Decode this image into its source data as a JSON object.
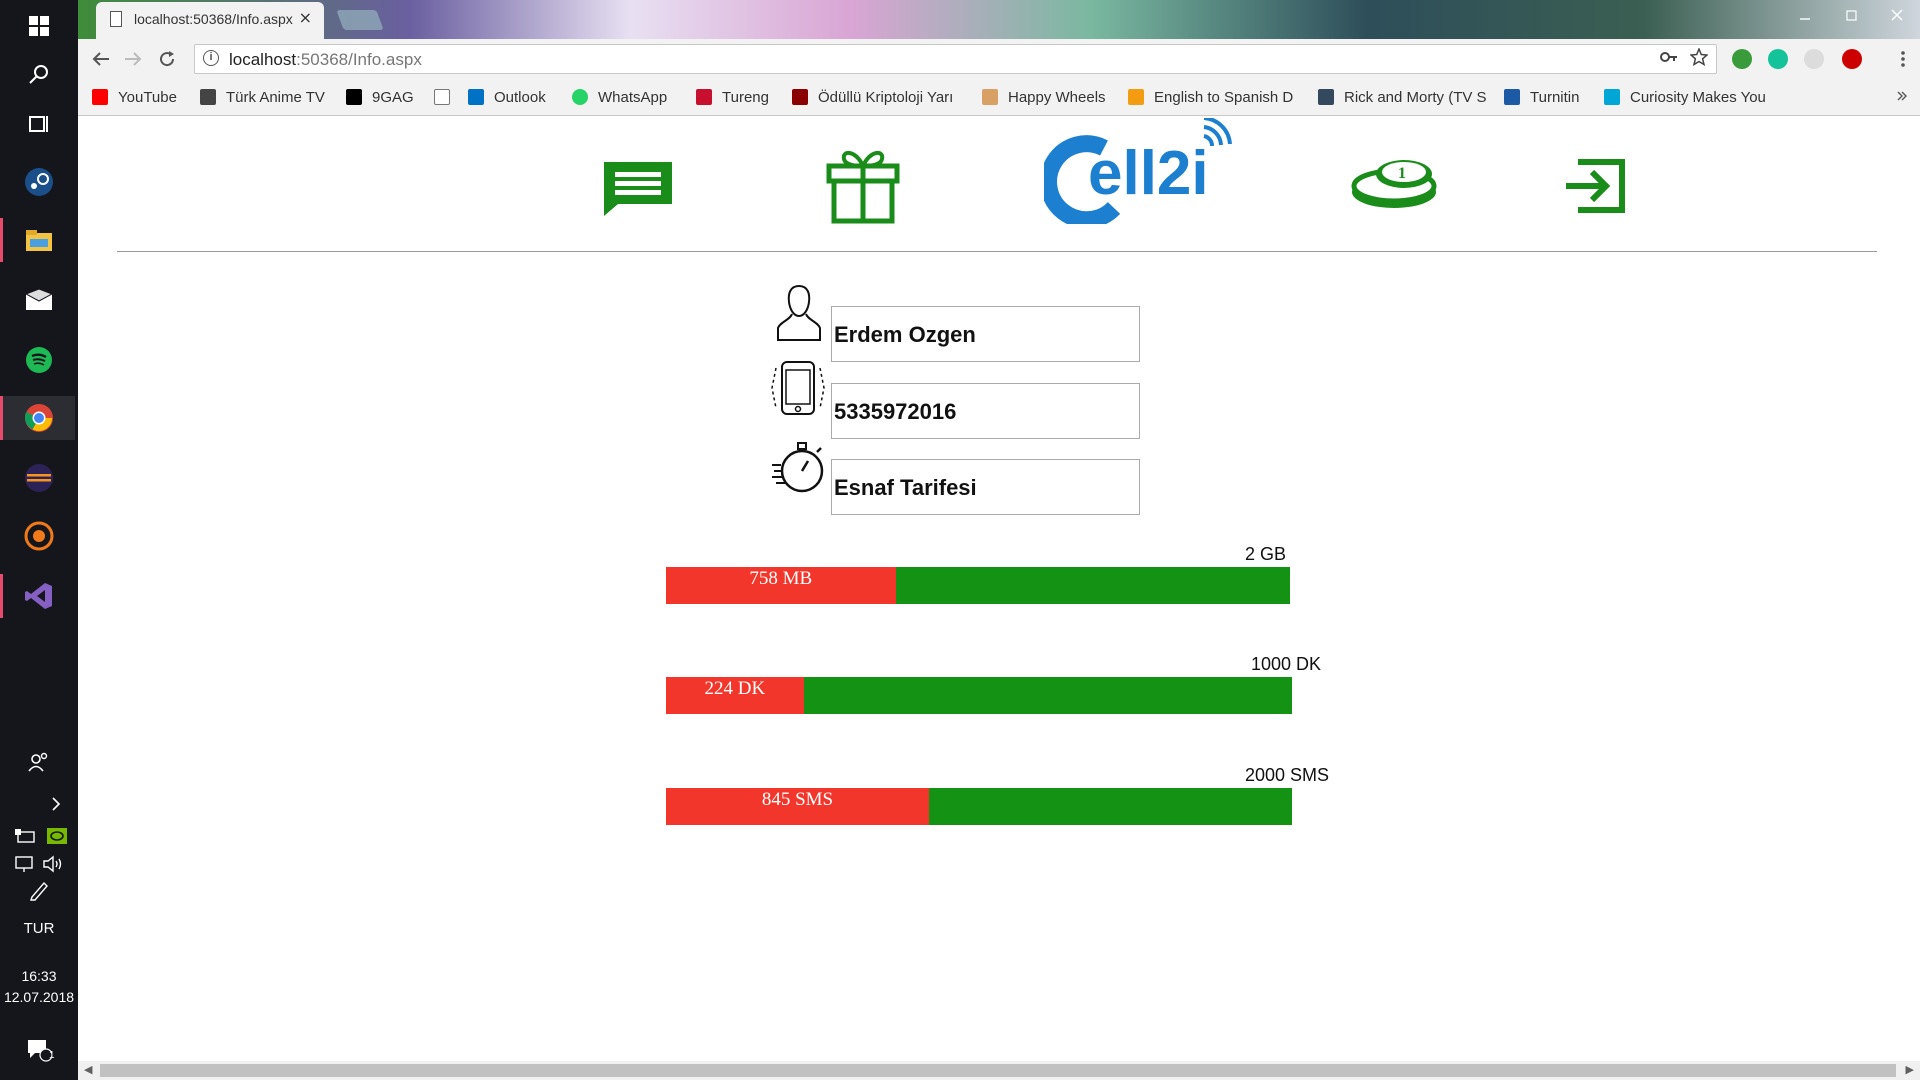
{
  "taskbar": {
    "lang": "TUR",
    "time": "16:33",
    "date": "12.07.2018",
    "notif_count": "1"
  },
  "browser": {
    "tab_title": "localhost:50368/Info.aspx",
    "tab_close": "×",
    "url_host": "localhost",
    "url_rest": ":50368/Info.aspx",
    "info_glyph": "i",
    "bookmarks": [
      {
        "label": "YouTube",
        "color": "#ff0000"
      },
      {
        "label": "Türk Anime TV",
        "color": "#444444"
      },
      {
        "label": "9GAG",
        "color": "#000000"
      },
      {
        "label": "",
        "color": "#ffffff"
      },
      {
        "label": "Outlook",
        "color": "#0072c6"
      },
      {
        "label": "WhatsApp",
        "color": "#25d366"
      },
      {
        "label": "Tureng",
        "color": "#c8102e"
      },
      {
        "label": "Ödüllü Kriptoloji Yarı",
        "color": "#8b0000"
      },
      {
        "label": "Happy Wheels",
        "color": "#d9a066"
      },
      {
        "label": "English to Spanish D",
        "color": "#f39c12"
      },
      {
        "label": "Rick and Morty (TV S",
        "color": "#34495e"
      },
      {
        "label": "Turnitin",
        "color": "#1c5aa6"
      },
      {
        "label": "Curiosity Makes You",
        "color": "#00a6d6"
      }
    ]
  },
  "nav": {
    "logo_text": "ell2i",
    "coin_label": "1",
    "icons": [
      "message-icon",
      "gift-icon",
      "cell2i-logo",
      "coin-icon",
      "exit-icon"
    ],
    "green": "#1a8c1a",
    "logo_blue": "#1c7fd0"
  },
  "profile": {
    "name": "Erdem Ozgen",
    "phone": "5335972016",
    "plan": "Esnaf Tarifesi"
  },
  "usage": [
    {
      "total_label": "2 GB",
      "used_label": "758 MB",
      "used_fraction": 0.368
    },
    {
      "total_label": "1000 DK",
      "used_label": "224 DK",
      "used_fraction": 0.22
    },
    {
      "total_label": "2000 SMS",
      "used_label": "845 SMS",
      "used_fraction": 0.42
    }
  ],
  "colors": {
    "used": "#f2362b",
    "remaining": "#139214"
  }
}
